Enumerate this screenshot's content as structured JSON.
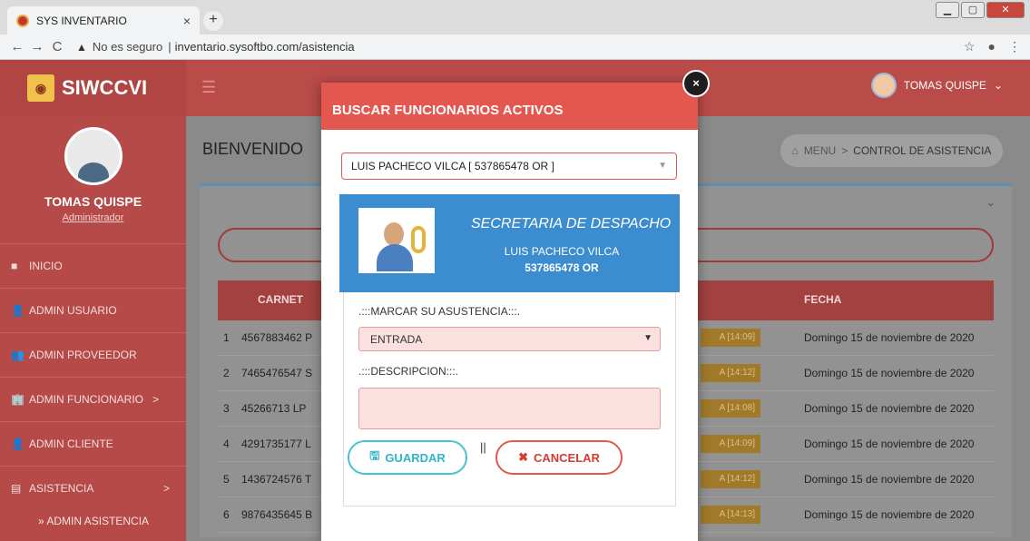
{
  "browser": {
    "tab_title": "SYS INVENTARIO",
    "tab_close": "×",
    "new_tab": "+",
    "security_label": "No es seguro",
    "url": "inventario.sysoftbo.com/asistencia"
  },
  "app": {
    "brand": "SIWCCVI",
    "user_name": "TOMAS QUISPE",
    "user_caret": "⌄"
  },
  "sidebar": {
    "profile_name": "TOMAS QUISPE",
    "profile_role": "Administrador",
    "items": [
      {
        "label": "INICIO",
        "icon": "■"
      },
      {
        "label": "ADMIN USUARIO",
        "icon": "👤"
      },
      {
        "label": "ADMIN PROVEEDOR",
        "icon": "👥"
      },
      {
        "label": "ADMIN FUNCIONARIO",
        "icon": "🏢",
        "arrow": ">"
      },
      {
        "label": "ADMIN CLIENTE",
        "icon": "👤"
      },
      {
        "label": "ASISTENCIA",
        "icon": "▤",
        "arrow": ">"
      }
    ],
    "sub_item": "» ADMIN ASISTENCIA"
  },
  "content": {
    "page_title": "BIENVENIDO",
    "breadcrumb_home": "MENU",
    "breadcrumb_sep": ">",
    "breadcrumb_current": "CONTROL DE ASISTENCIA",
    "table_headers": {
      "carnet": "CARNET",
      "fecha": "FECHA"
    },
    "rows": [
      {
        "n": "1",
        "carnet": "4567883462 P",
        "badge": "A [14:09]",
        "fecha": "Domingo 15 de noviembre de 2020"
      },
      {
        "n": "2",
        "carnet": "7465476547 S",
        "badge": "A [14:12]",
        "fecha": "Domingo 15 de noviembre de 2020"
      },
      {
        "n": "3",
        "carnet": "45266713 LP",
        "badge": "A [14:08]",
        "fecha": "Domingo 15 de noviembre de 2020"
      },
      {
        "n": "4",
        "carnet": "4291735177 L",
        "badge": "A [14:09]",
        "fecha": "Domingo 15 de noviembre de 2020"
      },
      {
        "n": "5",
        "carnet": "1436724576 T",
        "badge": "A [14:12]",
        "fecha": "Domingo 15 de noviembre de 2020"
      },
      {
        "n": "6",
        "carnet": "9876435645 B",
        "badge": "A [14:13]",
        "fecha": "Domingo 15 de noviembre de 2020"
      }
    ]
  },
  "modal": {
    "title": "BUSCAR FUNCIONARIOS ACTIVOS",
    "close": "×",
    "selected_funcionario": "LUIS PACHECO VILCA [ 537865478 OR ]",
    "card_department": "SECRETARIA DE DESPACHO",
    "card_name": "LUIS PACHECO VILCA",
    "card_id": "537865478 OR",
    "mark_label": ".:::MARCAR SU ASUSTENCIA:::.",
    "mark_value": "ENTRADA",
    "desc_label": ".:::DESCRIPCION:::.",
    "save_label": "GUARDAR",
    "separator": "||",
    "cancel_label": "CANCELAR"
  },
  "colors": {
    "header": "#b94b49",
    "modal_header": "#e4574f",
    "card": "#3c8dd0",
    "save": "#2fb6c8",
    "cancel": "#d33b33"
  }
}
